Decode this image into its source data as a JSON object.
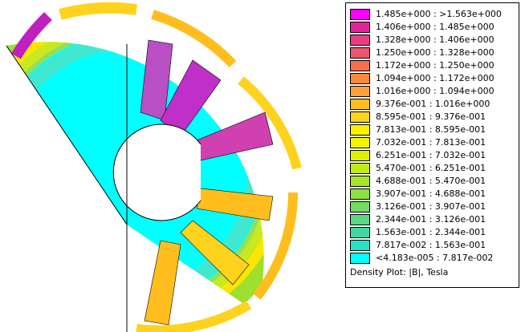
{
  "legend": {
    "entries": [
      {
        "label": "1.485e+000 : >1.563e+000",
        "color": "#ff00ff"
      },
      {
        "label": "1.406e+000 : 1.485e+000",
        "color": "#e1239b"
      },
      {
        "label": "1.328e+000 : 1.406e+000",
        "color": "#ea3c82"
      },
      {
        "label": "1.250e+000 : 1.328e+000",
        "color": "#f0556e"
      },
      {
        "label": "1.172e+000 : 1.250e+000",
        "color": "#f56e50"
      },
      {
        "label": "1.094e+000 : 1.172e+000",
        "color": "#f98a3a"
      },
      {
        "label": "1.016e+000 : 1.094e+000",
        "color": "#fca23a"
      },
      {
        "label": "9.376e-001 : 1.016e+000",
        "color": "#ffbe1e"
      },
      {
        "label": "8.595e-001 : 9.376e-001",
        "color": "#ffd21e"
      },
      {
        "label": "7.813e-001 : 8.595e-001",
        "color": "#fff000"
      },
      {
        "label": "7.032e-001 : 7.813e-001",
        "color": "#f5f500"
      },
      {
        "label": "6.251e-001 : 7.032e-001",
        "color": "#dcf000"
      },
      {
        "label": "5.470e-001 : 6.251e-001",
        "color": "#c3eb14"
      },
      {
        "label": "4.688e-001 : 5.470e-001",
        "color": "#a5e628"
      },
      {
        "label": "3.907e-001 : 4.688e-001",
        "color": "#8ce146"
      },
      {
        "label": "3.126e-001 : 3.907e-001",
        "color": "#73dc64"
      },
      {
        "label": "2.344e-001 : 3.126e-001",
        "color": "#5ad782"
      },
      {
        "label": "1.563e-001 : 2.344e-001",
        "color": "#41d7a0"
      },
      {
        "label": "7.817e-002 : 1.563e-001",
        "color": "#28e1c3"
      },
      {
        "label": "<4.183e-005 : 7.817e-002",
        "color": "#00ffff"
      }
    ],
    "caption": "Density Plot: |B|, Tesla"
  }
}
